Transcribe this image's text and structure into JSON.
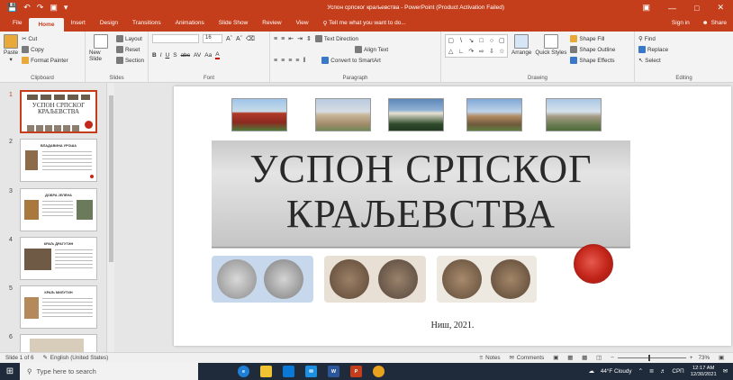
{
  "titlebar": {
    "title": "Успон српског краљевства - PowerPoint (Product Activation Failed)"
  },
  "tabs": [
    "File",
    "Home",
    "Insert",
    "Design",
    "Transitions",
    "Animations",
    "Slide Show",
    "Review",
    "View"
  ],
  "tab_active": "Home",
  "tell_me": "Tell me what you want to do...",
  "sign_in": "Sign in",
  "share": "Share",
  "ribbon": {
    "clipboard": {
      "paste": "Paste",
      "cut": "Cut",
      "copy": "Copy",
      "format_painter": "Format Painter",
      "label": "Clipboard"
    },
    "slides": {
      "new_slide": "New Slide",
      "layout": "Layout",
      "reset": "Reset",
      "section": "Section",
      "label": "Slides"
    },
    "font": {
      "size": "16",
      "label": "Font"
    },
    "paragraph": {
      "text_direction": "Text Direction",
      "align_text": "Align Text",
      "convert_smartart": "Convert to SmartArt",
      "label": "Paragraph"
    },
    "drawing": {
      "arrange": "Arrange",
      "quick_styles": "Quick Styles",
      "shape_fill": "Shape Fill",
      "shape_outline": "Shape Outline",
      "shape_effects": "Shape Effects",
      "label": "Drawing"
    },
    "editing": {
      "find": "Find",
      "replace": "Replace",
      "select": "Select",
      "label": "Editing"
    }
  },
  "thumbnails": [
    {
      "num": "1",
      "title": "УСПОН СРПСКОГ КРАЉЕВСТВА"
    },
    {
      "num": "2",
      "title": "ВЛАДАВИНА УРОША"
    },
    {
      "num": "3",
      "title": "ДОБРА ЈЕЛЕНА"
    },
    {
      "num": "4",
      "title": "КРАЉ ДРАГУТИН"
    },
    {
      "num": "5",
      "title": "КРАЉ МИЛУТИН"
    },
    {
      "num": "6",
      "title": ""
    }
  ],
  "slide": {
    "title_line1": "УСПОН СРПСКОГ",
    "title_line2": "КРАЉЕВСТВА",
    "place_year": "Ниш, 2021."
  },
  "status": {
    "slide_count": "Slide 1 of 6",
    "language": "English (United States)",
    "notes": "Notes",
    "comments": "Comments",
    "zoom": "73%"
  },
  "taskbar": {
    "search_placeholder": "Type here to search",
    "weather": "44°F Cloudy",
    "lang": "СРП",
    "time": "12:17 AM",
    "date": "12/30/2021"
  },
  "colors": {
    "accent": "#c43e1c",
    "seal": "#c4261a",
    "taskbar": "#1f2b3a"
  }
}
